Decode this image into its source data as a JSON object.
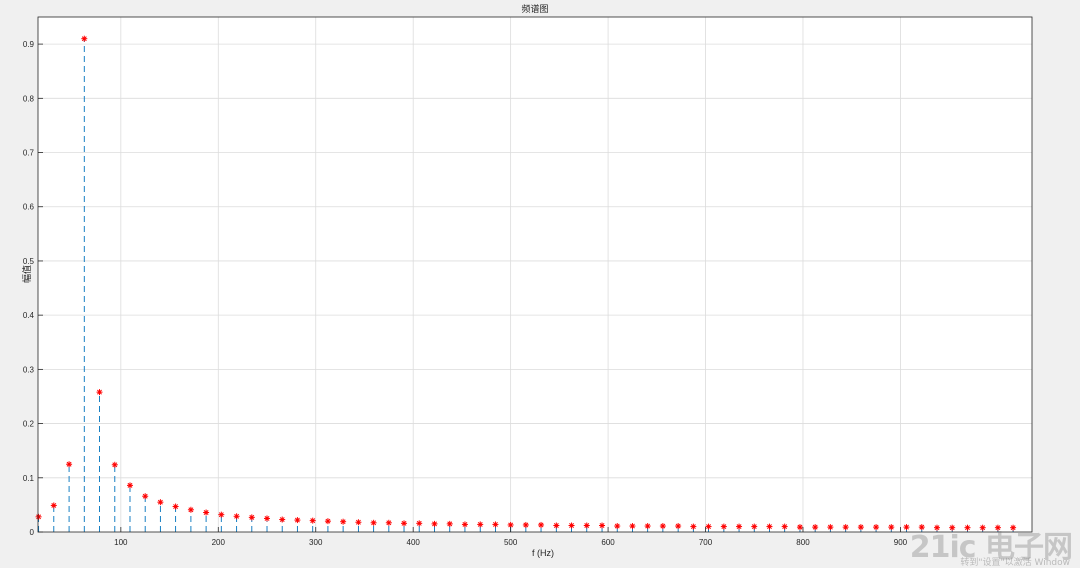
{
  "chart_data": {
    "type": "stem",
    "title": "频谱图",
    "xlabel": "f (Hz)",
    "ylabel": "幅值",
    "xlim": [
      15,
      1035
    ],
    "ylim": [
      0,
      0.95
    ],
    "xticks": [
      100,
      200,
      300,
      400,
      500,
      600,
      700,
      800,
      900
    ],
    "yticks": [
      0,
      0.1,
      0.2,
      0.3,
      0.4,
      0.5,
      0.6,
      0.7,
      0.8,
      0.9
    ],
    "grid": true,
    "stem_color": "#0072BD",
    "marker_color": "#ff0000",
    "marker": "*",
    "x": [
      15.6,
      31.2,
      46.9,
      62.5,
      78.1,
      93.8,
      109.4,
      125,
      140.6,
      156.2,
      171.9,
      187.5,
      203.1,
      218.8,
      234.4,
      250,
      265.6,
      281.2,
      296.9,
      312.5,
      328.1,
      343.8,
      359.4,
      375,
      390.6,
      406.2,
      421.9,
      437.5,
      453.1,
      468.8,
      484.4,
      500,
      515.6,
      531.2,
      546.9,
      562.5,
      578.1,
      593.8,
      609.4,
      625,
      640.6,
      656.2,
      671.9,
      687.5,
      703.1,
      718.8,
      734.4,
      750,
      765.6,
      781.2,
      796.9,
      812.5,
      828.1,
      843.8,
      859.4,
      875,
      890.6,
      906.2,
      921.9,
      937.5,
      953.1,
      968.8,
      984.4,
      1000,
      1015.6
    ],
    "y": [
      0.028,
      0.049,
      0.125,
      0.91,
      0.258,
      0.124,
      0.086,
      0.066,
      0.055,
      0.047,
      0.041,
      0.036,
      0.032,
      0.029,
      0.027,
      0.025,
      0.023,
      0.022,
      0.021,
      0.02,
      0.019,
      0.018,
      0.017,
      0.017,
      0.016,
      0.016,
      0.015,
      0.015,
      0.014,
      0.014,
      0.014,
      0.013,
      0.013,
      0.013,
      0.012,
      0.012,
      0.012,
      0.012,
      0.011,
      0.011,
      0.011,
      0.011,
      0.011,
      0.01,
      0.01,
      0.01,
      0.01,
      0.01,
      0.01,
      0.01,
      0.009,
      0.009,
      0.009,
      0.009,
      0.009,
      0.009,
      0.009,
      0.009,
      0.009,
      0.008,
      0.008,
      0.008,
      0.008,
      0.008,
      0.008
    ]
  },
  "watermark": {
    "brand": "21ic 电子网",
    "sub": "转到\"设置\"以激活 Window"
  }
}
